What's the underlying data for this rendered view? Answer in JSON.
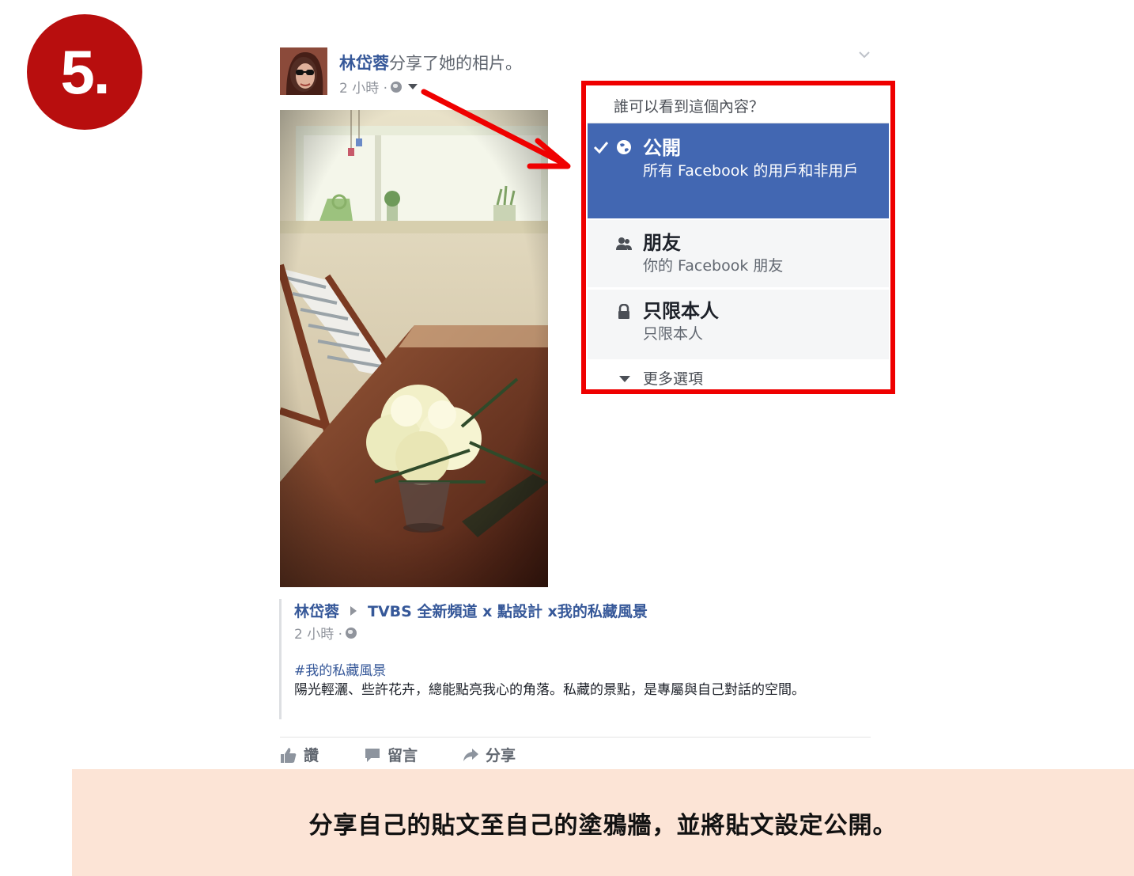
{
  "step": {
    "label": "5."
  },
  "post": {
    "author": "林岱蓉",
    "action": "分享了她的相片。",
    "time": "2 小時 ·"
  },
  "privacy_menu": {
    "title": "誰可以看到這個內容？",
    "options": [
      {
        "label": "公開",
        "description": "所有 Facebook 的用戶和非用戶",
        "icon": "globe-icon",
        "selected": true
      },
      {
        "label": "朋友",
        "description": "你的 Facebook 朋友",
        "icon": "friends-icon",
        "selected": false
      },
      {
        "label": "只限本人",
        "description": "只限本人",
        "icon": "lock-icon",
        "selected": false
      }
    ],
    "more": "更多選項"
  },
  "shared": {
    "author": "林岱蓉",
    "target": "TVBS 全新頻道 x 點設計 x我的私藏風景",
    "time": "2 小時 ·",
    "hashtag": "#我的私藏風景",
    "body": "陽光輕灑、些許花卉，總能點亮我心的角落。私藏的景點，是專屬與自己對話的空間。"
  },
  "actions": {
    "like": "讚",
    "comment": "留言",
    "share": "分享"
  },
  "caption": "分享自己的貼文至自己的塗鴉牆，並將貼文設定公開。",
  "colors": {
    "fb_blue": "#4267b2",
    "link_blue": "#365899",
    "highlight_red": "#ef0000",
    "badge_red": "#b80e0e",
    "banner_bg": "#fce4d6"
  }
}
